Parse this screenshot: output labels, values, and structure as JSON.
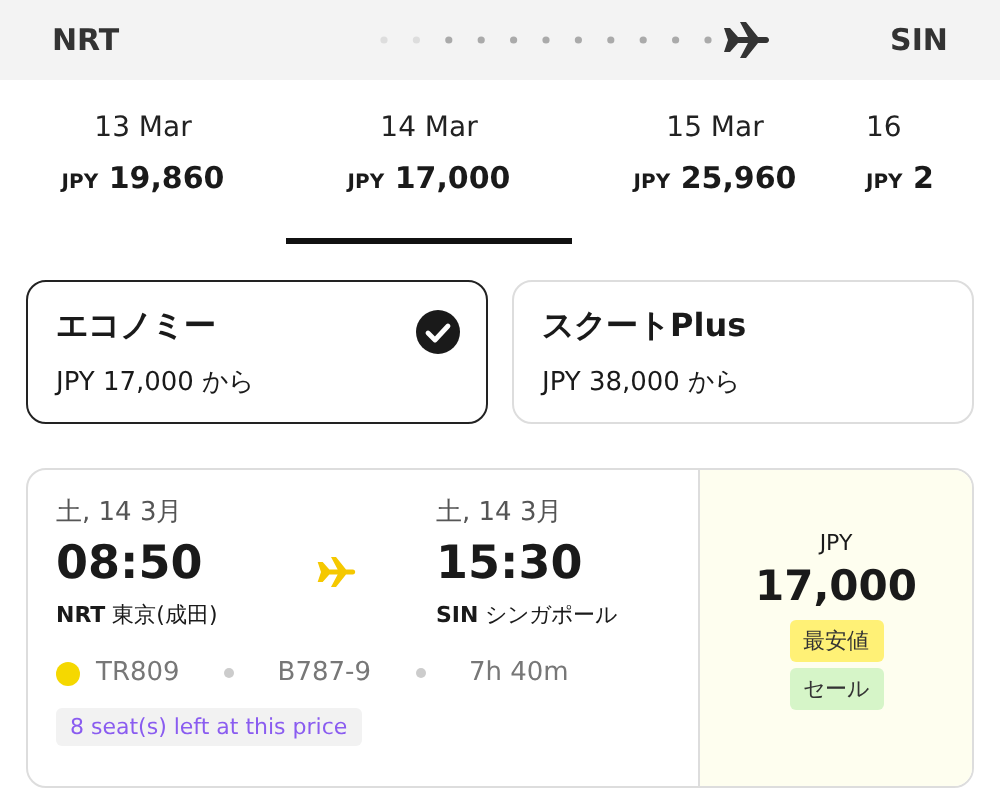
{
  "route": {
    "origin": "NRT",
    "destination": "SIN"
  },
  "date_tabs": [
    {
      "date": "13 Mar",
      "currency": "JPY",
      "price": "19,860",
      "selected": false
    },
    {
      "date": "14 Mar",
      "currency": "JPY",
      "price": "17,000",
      "selected": true
    },
    {
      "date": "15 Mar",
      "currency": "JPY",
      "price": "25,960",
      "selected": false
    },
    {
      "date": "16",
      "currency": "JPY",
      "price": "2",
      "selected": false
    }
  ],
  "fare_classes": [
    {
      "name": "エコノミー",
      "price": "JPY 17,000 から",
      "selected": true
    },
    {
      "name": "スクートPlus",
      "price": "JPY 38,000 から",
      "selected": false
    }
  ],
  "flight": {
    "departure": {
      "date": "土, 14 3月",
      "time": "08:50",
      "code": "NRT",
      "city": "東京(成田)"
    },
    "arrival": {
      "date": "土, 14 3月",
      "time": "15:30",
      "code": "SIN",
      "city": "シンガポール"
    },
    "flight_number": "TR809",
    "aircraft": "B787-9",
    "duration": "7h 40m",
    "seats_notice": "8 seat(s) left at this price",
    "price": {
      "currency": "JPY",
      "amount": "17,000"
    },
    "badges": [
      {
        "label": "最安値",
        "color": "#fff176"
      },
      {
        "label": "セール",
        "color": "#d6f5c8"
      }
    ]
  }
}
